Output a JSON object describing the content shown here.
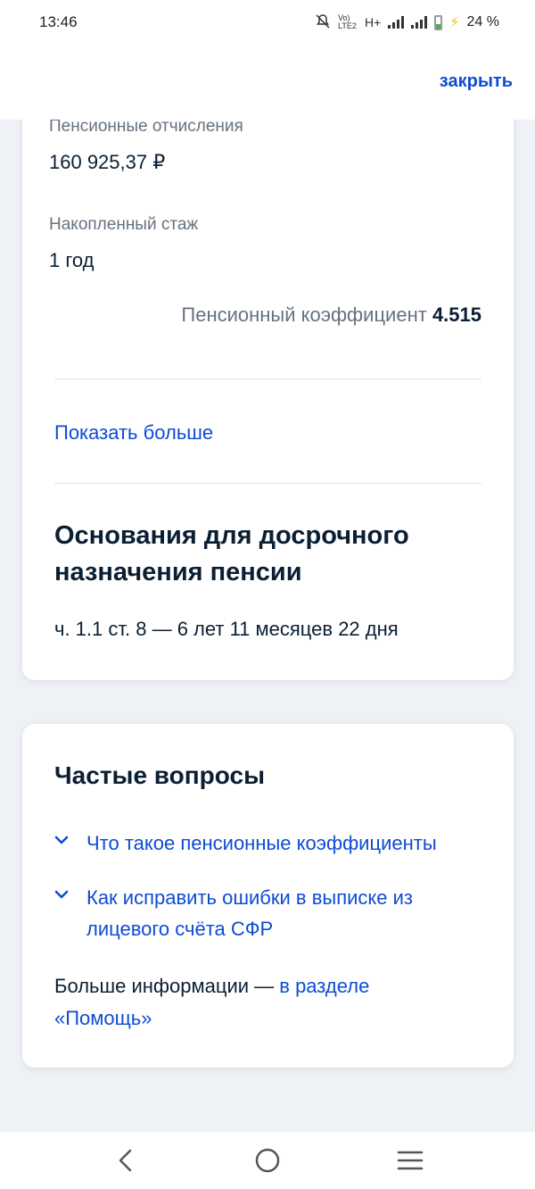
{
  "status_bar": {
    "time": "13:46",
    "network": "H+",
    "volte": "Vo) LTE2",
    "battery_percent": "24 %",
    "icons": [
      "mute-icon",
      "volte-icon",
      "signal-icon",
      "battery-icon",
      "charging-icon"
    ]
  },
  "header": {
    "close_label": "закрыть"
  },
  "pension_card": {
    "contributions_label": "Пенсионные отчисления",
    "contributions_value": "160 925,37 ₽",
    "experience_label": "Накопленный стаж",
    "experience_value": "1 год",
    "coefficient_label": "Пенсионный коэффициент",
    "coefficient_value": "4.515",
    "show_more": "Показать больше",
    "early_title": "Основания для досрочного назначения пенсии",
    "early_text": "ч. 1.1 ст. 8 — 6 лет 11 месяцев 22 дня"
  },
  "faq": {
    "title": "Частые вопросы",
    "items": [
      {
        "text": "Что такое пенсионные коэффициенты"
      },
      {
        "text": "Как исправить ошибки в выписке из лицевого счёта СФР"
      }
    ],
    "more_prefix": "Больше информации — ",
    "more_link": "в разделе «Помощь»"
  },
  "colors": {
    "accent": "#0d4cd3",
    "text": "#0b1f33",
    "muted": "#66727f",
    "background": "#eef1f5"
  }
}
